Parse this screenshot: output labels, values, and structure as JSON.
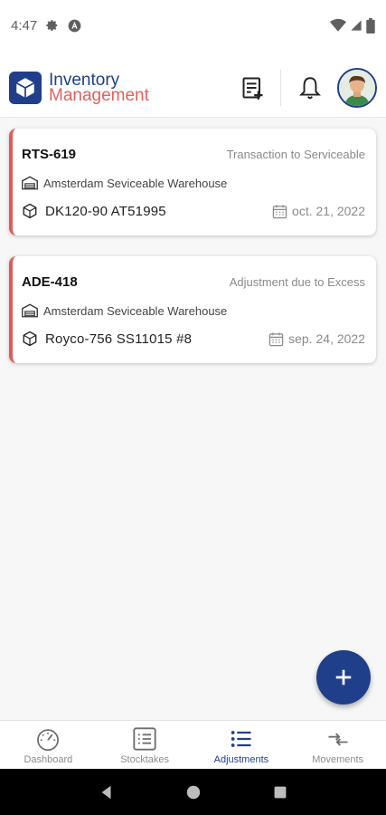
{
  "status_bar": {
    "time": "4:47"
  },
  "app": {
    "title_line1": "Inventory",
    "title_line2": "Management",
    "colors": {
      "primary": "#1f3f8a",
      "accent": "#e2605f",
      "card_stripe": "#e05a5a"
    }
  },
  "cards": [
    {
      "code": "RTS-619",
      "type": "Transaction to Serviceable",
      "warehouse": "Amsterdam Seviceable Warehouse",
      "item": "DK120-90  AT51995",
      "date": "oct. 21, 2022"
    },
    {
      "code": "ADE-418",
      "type": "Adjustment due to Excess",
      "warehouse": "Amsterdam Seviceable Warehouse",
      "item": "Royco-756  SS11015  #8",
      "date": "sep. 24, 2022"
    }
  ],
  "bottom_nav": [
    {
      "label": "Dashboard",
      "icon": "gauge-icon",
      "active": false
    },
    {
      "label": "Stocktakes",
      "icon": "list-box-icon",
      "active": false
    },
    {
      "label": "Adjustments",
      "icon": "bullet-list-icon",
      "active": true
    },
    {
      "label": "Movements",
      "icon": "arrows-icon",
      "active": false
    }
  ],
  "icons": {
    "fab": "plus-icon",
    "header_actions": [
      "add-note-icon",
      "bell-icon"
    ]
  }
}
